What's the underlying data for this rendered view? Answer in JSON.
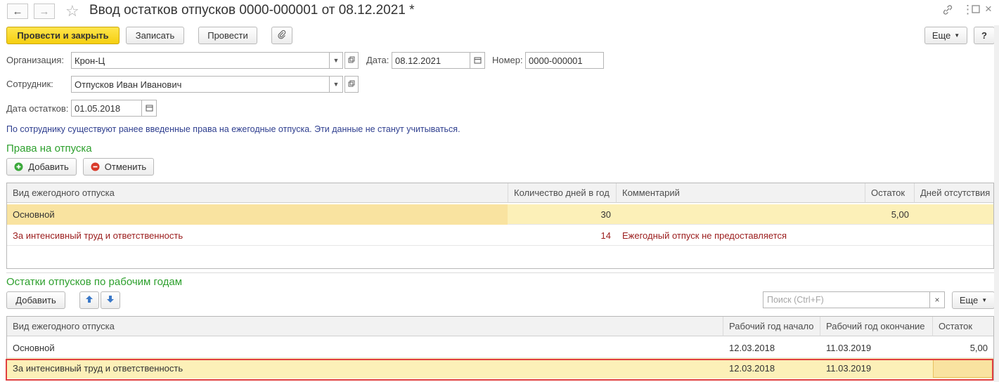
{
  "window": {
    "title": "Ввод остатков отпусков 0000-000001 от 08.12.2021 *",
    "back_icon": "arrow-left-icon",
    "forward_icon": "arrow-right-icon",
    "favorite_icon": "star-icon",
    "link_icon": "link-icon",
    "menu_icon": "more-icon",
    "maximize_icon": "maximize-icon",
    "close_icon": "close-icon"
  },
  "toolbar": {
    "post_close": "Провести и закрыть",
    "save": "Записать",
    "post": "Провести",
    "attach_icon": "paperclip-icon",
    "more": "Еще",
    "help": "?"
  },
  "form": {
    "org_label": "Организация:",
    "org_value": "Крон-Ц",
    "date_label": "Дата:",
    "date_value": "08.12.2021",
    "number_label": "Номер:",
    "number_value": "0000-000001",
    "employee_label": "Сотрудник:",
    "employee_value": "Отпусков Иван Иванович",
    "balance_date_label": "Дата остатков:",
    "balance_date_value": "01.05.2018"
  },
  "info_message": "По сотруднику существуют ранее введенные права на ежегодные отпуска. Эти данные не станут учитываться.",
  "rights": {
    "title": "Права на отпуска",
    "add_button": "Добавить",
    "cancel_button": "Отменить",
    "columns": [
      "Вид ежегодного отпуска",
      "Количество дней в год",
      "Комментарий",
      "Остаток",
      "Дней отсутствия"
    ],
    "rows": [
      {
        "type": "Основной",
        "days": "30",
        "comment": "",
        "balance": "5,00",
        "absent": ""
      },
      {
        "type": "За интенсивный труд и ответственность",
        "days": "14",
        "comment": "Ежегодный отпуск не предоставляется",
        "balance": "",
        "absent": ""
      }
    ]
  },
  "balances": {
    "title": "Остатки отпусков по рабочим годам",
    "add_button": "Добавить",
    "up_icon": "arrow-up-icon",
    "down_icon": "arrow-down-icon",
    "search_placeholder": "Поиск (Ctrl+F)",
    "clear_icon": "clear-icon",
    "more": "Еще",
    "columns": [
      "Вид ежегодного отпуска",
      "Рабочий год начало",
      "Рабочий год окончание",
      "Остаток"
    ],
    "rows": [
      {
        "type": "Основной",
        "start": "12.03.2018",
        "end": "11.03.2019",
        "balance": "5,00"
      },
      {
        "type": "За интенсивный труд и ответственность",
        "start": "12.03.2018",
        "end": "11.03.2019",
        "balance": ""
      }
    ]
  },
  "colors": {
    "accent_yellow": "#f5cf10",
    "section_green": "#2ea02e",
    "selected_row": "#fcf0b8",
    "disabled_text": "#9b1c1c",
    "highlight_border": "#e04040"
  }
}
